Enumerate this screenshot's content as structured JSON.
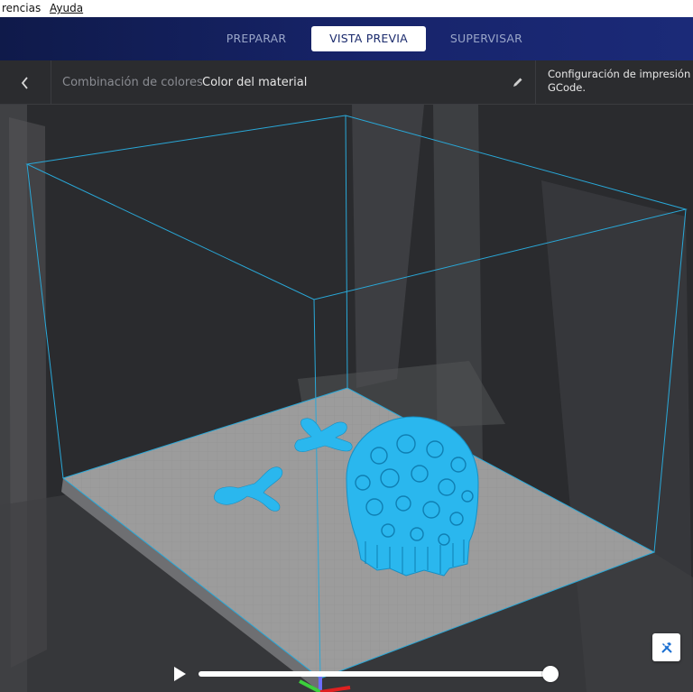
{
  "menubar": {
    "items": [
      {
        "label": "rencias"
      },
      {
        "label": "Ayuda"
      }
    ]
  },
  "stages": [
    {
      "label": "PREPARAR",
      "active": false
    },
    {
      "label": "VISTA PREVIA",
      "active": true
    },
    {
      "label": "SUPERVISAR",
      "active": false
    }
  ],
  "toolbar": {
    "back_icon": "chevron-left-icon",
    "color_scheme_label": "Combinación de colores",
    "color_scheme_value": "Color del material",
    "edit_icon": "pencil-icon",
    "print_settings_line1": "Configuración de impresión de",
    "print_settings_line2": "GCode."
  },
  "viewport": {
    "build_volume_color": "#29a8d8",
    "model_color": "#2ab7ee",
    "plate_color": "#9c9c9c",
    "objects": [
      "bone-model-1",
      "bone-model-2",
      "brain-model"
    ]
  },
  "simulation": {
    "play_icon": "play-icon",
    "layer_progress": 1.0
  },
  "tool_button": {
    "icon": "tools-icon"
  }
}
